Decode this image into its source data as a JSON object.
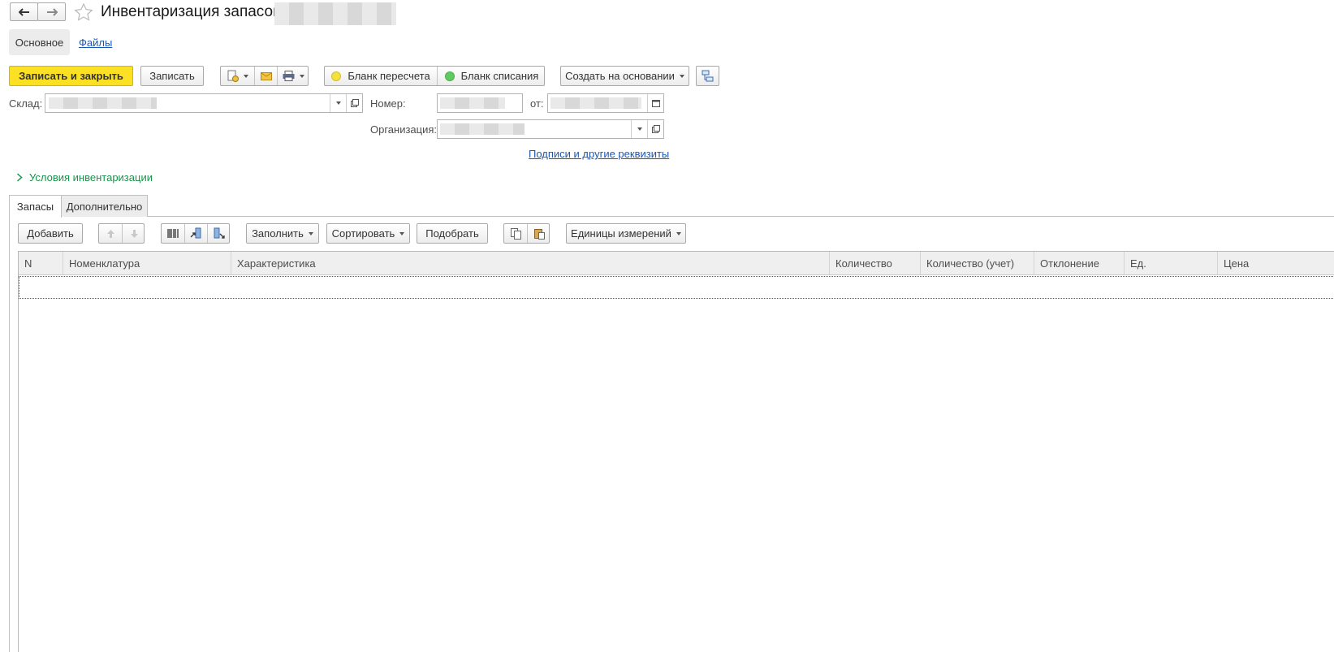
{
  "window": {
    "title": "Инвентаризация запасов",
    "back_icon": "arrow-left-icon",
    "forward_icon": "arrow-right-icon",
    "favorite_icon": "star-icon"
  },
  "nav": {
    "main": "Основное",
    "files": "Файлы"
  },
  "toolbar": {
    "save_close": "Записать и закрыть",
    "save": "Записать",
    "recount_form": "Бланк пересчета",
    "writeoff_form": "Бланк списания",
    "create_based": "Создать на основании",
    "recount_color": "#f6e03b",
    "writeoff_color": "#5ecb5e"
  },
  "form": {
    "warehouse_label": "Склад:",
    "number_label": "Номер:",
    "date_label": "от:",
    "organization_label": "Организация:",
    "signatures_link": "Подписи и другие реквизиты",
    "conditions": "Условия инвентаризации"
  },
  "tabs": {
    "stock": "Запасы",
    "extra": "Дополнительно"
  },
  "table_toolbar": {
    "add": "Добавить",
    "fill": "Заполнить",
    "sort": "Сортировать",
    "pick": "Подобрать",
    "units": "Единицы измерений"
  },
  "table": {
    "columns": [
      "N",
      "Номенклатура",
      "Характеристика",
      "Количество",
      "Количество (учет)",
      "Отклонение",
      "Ед.",
      "Цена"
    ],
    "rows": []
  }
}
